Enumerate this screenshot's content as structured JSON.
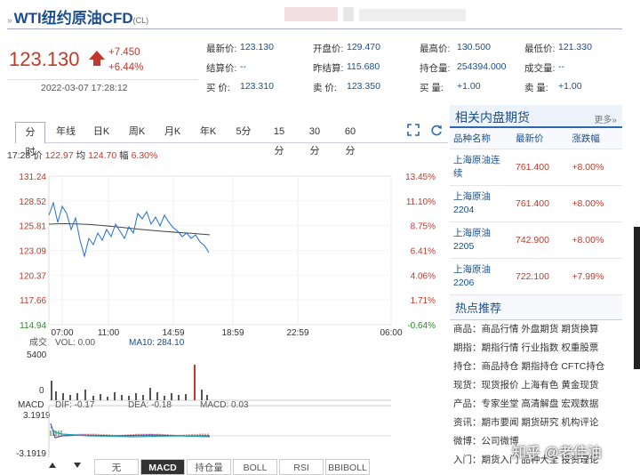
{
  "header": {
    "prefix": "»",
    "title": "WTI纽约原油CFD",
    "symbol": "(CL)"
  },
  "quote": {
    "price": "123.130",
    "change": "+7.450",
    "change_pct": "+6.44%",
    "datetime": "2022-03-07 17:28:12"
  },
  "stats": [
    [
      "最新价:",
      "123.130",
      "开盘价:",
      "129.470",
      "最高价:",
      "130.500",
      "最低价:",
      "121.330"
    ],
    [
      "结算价:",
      "--",
      "昨结算:",
      "115.680",
      "持仓量:",
      "254394.000",
      "成交量:",
      "--"
    ],
    [
      "买  价:",
      "123.310",
      "卖  价:",
      "123.350",
      "买  量:",
      "+1.00",
      "卖  量:",
      "+1.00"
    ]
  ],
  "tabs": [
    "分时",
    "年线",
    "日K",
    "周K",
    "月K",
    "年K",
    "5分",
    "15分",
    "30分",
    "60分"
  ],
  "info": {
    "time": "17:28",
    "price_label": "价",
    "price": "122.97",
    "avg_label": "均",
    "avg": "124.70",
    "amp_label": "幅",
    "amp": "6.30%"
  },
  "chart": {
    "y_labels": [
      "131.24",
      "128.52",
      "125.81",
      "123.09",
      "120.37",
      "117.66",
      "114.94"
    ],
    "pct_labels": [
      "13.45%",
      "11.10%",
      "8.75%",
      "6.41%",
      "4.06%",
      "1.71%",
      "-0.64%"
    ],
    "x_labels": [
      "07:00",
      "11:00",
      "14:59",
      "18:59",
      "22:59",
      "06:00"
    ]
  },
  "volume": {
    "label": "成交",
    "vol": "VOL: 0.00",
    "ma": "MA10: 284.10",
    "max": "5400",
    "zero": "0"
  },
  "macd": {
    "label": "MACD",
    "dif": "DIF: -0.17",
    "dea": "DEA: -0.18",
    "macd": "MACD: 0.03",
    "top": "3.1919",
    "bottom": "-3.1919"
  },
  "bottom_buttons": [
    "无",
    "MACD",
    "持仓量",
    "BOLL",
    "RSI",
    "BBIBOLL"
  ],
  "sidebar": {
    "title": "相关内盘期货",
    "more": "更多»",
    "columns": [
      "品种名称",
      "最新价",
      "涨跌幅"
    ],
    "rows": [
      {
        "name": "上海原油连续",
        "price": "761.400",
        "pct": "+8.00%"
      },
      {
        "name": "上海原油2204",
        "price": "761.400",
        "pct": "+8.00%"
      },
      {
        "name": "上海原油2205",
        "price": "742.900",
        "pct": "+8.00%"
      },
      {
        "name": "上海原油2206",
        "price": "722.100",
        "pct": "+7.99%"
      }
    ],
    "hot_title": "热点推荐",
    "hot": [
      {
        "k": "商品：",
        "v": "商品行情 外盘期货 期货换算"
      },
      {
        "k": "期指：",
        "v": "期指行情 行业指数 权重股票"
      },
      {
        "k": "持仓：",
        "v": "商品持仓 期指持仓 CFTC持仓"
      },
      {
        "k": "现货：",
        "v": "现货报价 上海有色 黄金现货"
      },
      {
        "k": "产品：",
        "v": "专家坐堂 高清解盘 宏观数据"
      },
      {
        "k": "资讯：",
        "v": "期市要闻 期货研究 机构评论"
      },
      {
        "k": "微博：",
        "v": "公司微博"
      },
      {
        "k": "入门：",
        "v": "期货入门 品种大全 投资理论"
      }
    ]
  },
  "watermark": "知乎 @老佳油",
  "colors": {
    "up": "#c0392b",
    "link": "#1a4e8c",
    "price_line": "#1f6fd6",
    "avg_line": "#444444",
    "dif": "#7b3fa0",
    "dea": "#1ca3b4"
  }
}
